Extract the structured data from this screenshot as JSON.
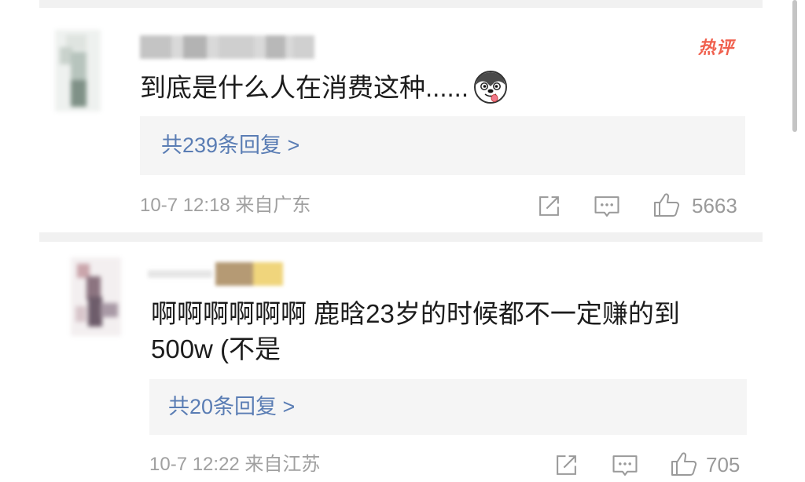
{
  "comments": [
    {
      "badge": "热评",
      "text": [
        "到底是什么人在消费这种......"
      ],
      "emoji": "husky-face-emoji",
      "replies": "共239条回复 >",
      "meta": "10-7 12:18 来自广东",
      "likes": "5663"
    },
    {
      "text": [
        "啊啊啊啊啊啊 鹿晗23岁的时候都不一定赚的到",
        "500w (不是"
      ],
      "replies": "共20条回复 >",
      "meta": "10-7 12:22 来自江苏",
      "likes": "705"
    }
  ],
  "icons": {
    "share": "share-icon",
    "comment": "comment-icon",
    "like": "thumbs-up-icon",
    "emoji": "husky-emoji-icon"
  },
  "colors": {
    "text": "#1c1c1c",
    "secondary": "#a0a0a0",
    "link": "#5a7db4",
    "reply_bg": "#f5f5f5",
    "badge": "#f0604e",
    "separator": "#f1f1f1"
  }
}
